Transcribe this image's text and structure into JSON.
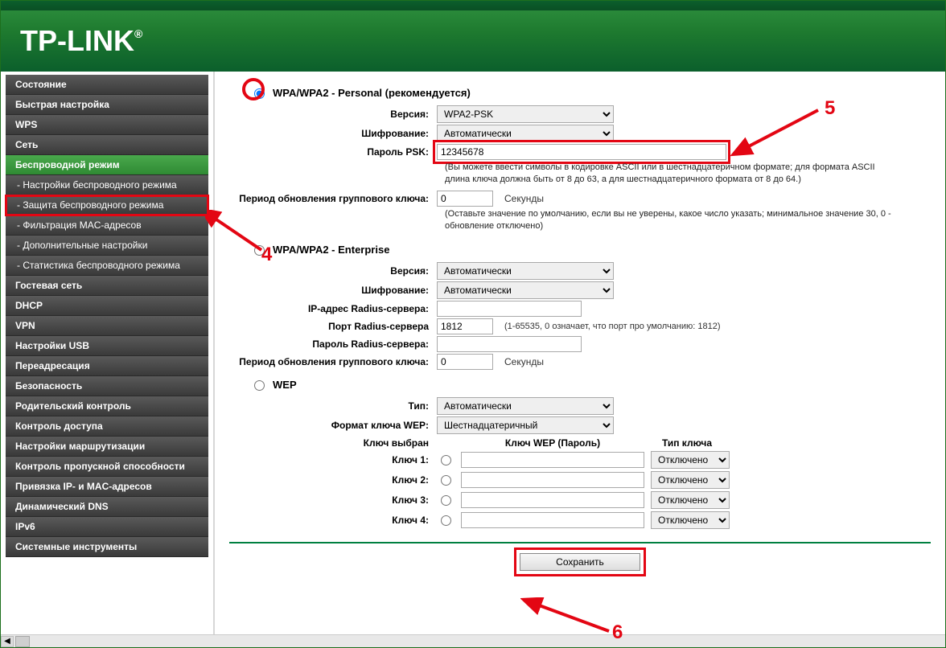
{
  "brand": "TP-LINK",
  "sidebar": {
    "items": [
      {
        "label": "Состояние",
        "type": "top"
      },
      {
        "label": "Быстрая настройка",
        "type": "top"
      },
      {
        "label": "WPS",
        "type": "top"
      },
      {
        "label": "Сеть",
        "type": "top"
      },
      {
        "label": "Беспроводной режим",
        "type": "top",
        "active": true
      },
      {
        "label": "- Настройки беспроводного режима",
        "type": "sub"
      },
      {
        "label": "- Защита беспроводного режима",
        "type": "sub",
        "highlighted": true
      },
      {
        "label": "- Фильтрация MAC-адресов",
        "type": "sub"
      },
      {
        "label": "- Дополнительные настройки",
        "type": "sub"
      },
      {
        "label": "- Статистика беспроводного режима",
        "type": "sub"
      },
      {
        "label": "Гостевая сеть",
        "type": "top"
      },
      {
        "label": "DHCP",
        "type": "top"
      },
      {
        "label": "VPN",
        "type": "top"
      },
      {
        "label": "Настройки USB",
        "type": "top"
      },
      {
        "label": "Переадресация",
        "type": "top"
      },
      {
        "label": "Безопасность",
        "type": "top"
      },
      {
        "label": "Родительский контроль",
        "type": "top"
      },
      {
        "label": "Контроль доступа",
        "type": "top"
      },
      {
        "label": "Настройки маршрутизации",
        "type": "top"
      },
      {
        "label": "Контроль пропускной способности",
        "type": "top"
      },
      {
        "label": "Привязка IP- и MAC-адресов",
        "type": "top"
      },
      {
        "label": "Динамический DNS",
        "type": "top"
      },
      {
        "label": "IPv6",
        "type": "top"
      },
      {
        "label": "Системные инструменты",
        "type": "top"
      }
    ]
  },
  "sections": {
    "personal": {
      "title": "WPA/WPA2 - Personal (рекомендуется)",
      "version_label": "Версия:",
      "version_value": "WPA2-PSK",
      "encryption_label": "Шифрование:",
      "encryption_value": "Автоматически",
      "psk_label": "Пароль PSK:",
      "psk_value": "12345678",
      "psk_note": "(Вы можете ввести символы в кодировке ASCII или в шестнадцатеричном формате; для формата ASCII длина ключа должна быть от 8 до 63, а для шестнадцатеричного формата от 8 до 64.)",
      "group_label": "Период обновления группового ключа:",
      "group_value": "0",
      "group_unit": "Секунды",
      "group_note": "(Оставьте значение по умолчанию, если вы не уверены, какое число указать; минимальное значение 30, 0 - обновление отключено)"
    },
    "enterprise": {
      "title": "WPA/WPA2 - Enterprise",
      "version_label": "Версия:",
      "version_value": "Автоматически",
      "encryption_label": "Шифрование:",
      "encryption_value": "Автоматически",
      "radius_ip_label": "IP-адрес Radius-сервера:",
      "radius_ip_value": "",
      "radius_port_label": "Порт Radius-сервера",
      "radius_port_value": "1812",
      "radius_port_note": "(1-65535, 0 означает, что порт про умолчанию: 1812)",
      "radius_pw_label": "Пароль Radius-сервера:",
      "radius_pw_value": "",
      "group_label": "Период обновления группового ключа:",
      "group_value": "0",
      "group_unit": "Секунды"
    },
    "wep": {
      "title": "WEP",
      "type_label": "Тип:",
      "type_value": "Автоматически",
      "fmt_label": "Формат ключа WEP:",
      "fmt_value": "Шестнадцатеричный",
      "col_selected": "Ключ выбран",
      "col_password": "Ключ WEP (Пароль)",
      "col_type": "Тип ключа",
      "keys": [
        {
          "label": "Ключ 1:",
          "pass": "",
          "type": "Отключено"
        },
        {
          "label": "Ключ 2:",
          "pass": "",
          "type": "Отключено"
        },
        {
          "label": "Ключ 3:",
          "pass": "",
          "type": "Отключено"
        },
        {
          "label": "Ключ 4:",
          "pass": "",
          "type": "Отключено"
        }
      ]
    }
  },
  "save_label": "Сохранить",
  "annotations": {
    "n4": "4",
    "n5": "5",
    "n6": "6"
  }
}
